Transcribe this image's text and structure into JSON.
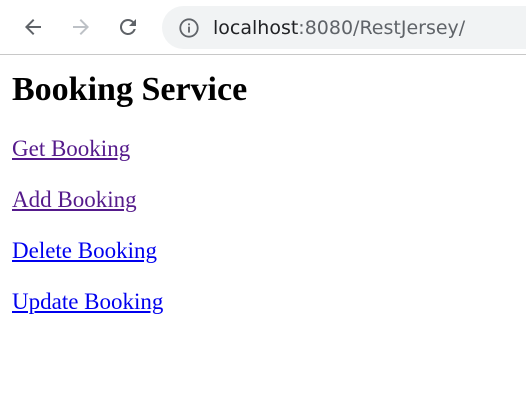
{
  "browser": {
    "url_host": "localhost",
    "url_rest": ":8080/RestJersey/",
    "icons": {
      "back": "back-arrow-icon",
      "forward": "forward-arrow-icon",
      "reload": "reload-icon",
      "info": "info-icon"
    }
  },
  "page": {
    "title": "Booking Service",
    "links": [
      {
        "label": "Get Booking",
        "visited": true
      },
      {
        "label": "Add Booking",
        "visited": true
      },
      {
        "label": "Delete Booking",
        "visited": false
      },
      {
        "label": "Update Booking",
        "visited": false
      }
    ]
  },
  "colors": {
    "visited_link": "#551a8b",
    "unvisited_link": "#0000ee"
  }
}
